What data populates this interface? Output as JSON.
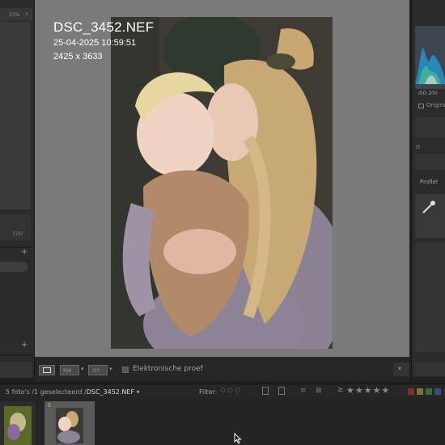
{
  "left_panel": {
    "zoom_value": "25%",
    "slider_value": "100",
    "add_symbol": "+"
  },
  "overlay": {
    "filename": "DSC_3452.NEF",
    "datetime": "25-04-2025 10:59:51",
    "dimensions": "2425 x 3633"
  },
  "toolbar": {
    "proof_label": "Elektronische proef",
    "proof_checked": false
  },
  "right_panel": {
    "iso": "ISO 200",
    "original_label": "Origine",
    "profile_label": "Profiel"
  },
  "filmstrip_bar": {
    "info_prefix": "5 foto's /1 geselecteerd /",
    "selected_file": "DSC_3452.NEF",
    "filter_label": "Filter:",
    "rating_stars": 5
  },
  "filmstrip": {
    "thumb_number": "5"
  },
  "colors": {
    "canvas_bg": "#7a7a7a",
    "panel_bg": "#2b2b2b",
    "accent_text": "#ffffff",
    "histogram_blue": "#2a86b8"
  },
  "icons": [
    "dropdown-arrow-icon",
    "plus-icon",
    "eyedropper-icon",
    "star-icon",
    "filter-flag-icon",
    "color-label-icon",
    "mouse-cursor-icon"
  ]
}
